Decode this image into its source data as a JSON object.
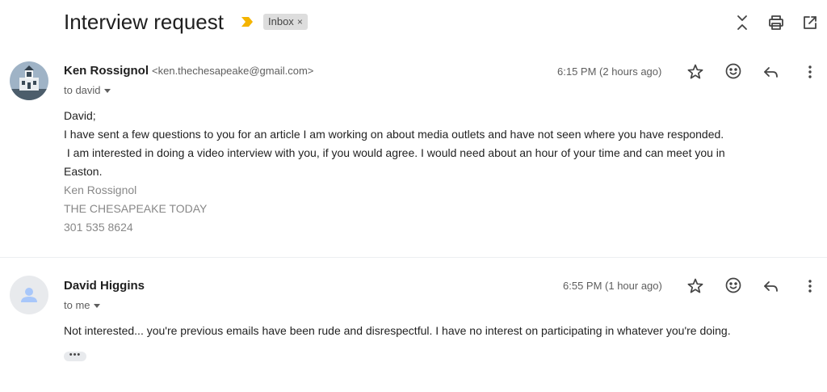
{
  "subject": "Interview request",
  "label": {
    "name": "Inbox",
    "close": "×"
  },
  "toolbar": {
    "icons": [
      "expand-collapse-icon",
      "print-icon",
      "open-new-window-icon"
    ]
  },
  "messages": [
    {
      "sender_name": "Ken Rossignol",
      "sender_email": "<ken.thechesapeake@gmail.com>",
      "to": "to david",
      "time": "6:15 PM (2 hours ago)",
      "body": [
        "David;",
        "I have sent a few questions to you for an article I am working on about media outlets and have not seen where you have responded.",
        " I am interested in doing a video interview with you, if you would agree. I would need about an hour of your time and can meet you in",
        "Easton."
      ],
      "signature": [
        "Ken Rossignol",
        "THE CHESAPEAKE TODAY",
        "301 535 8624"
      ]
    },
    {
      "sender_name": "David Higgins",
      "to": "to me",
      "time": "6:55 PM (1 hour ago)",
      "body": [
        "Not interested... you're previous emails have been rude and disrespectful. I have no interest on participating in whatever you're doing."
      ],
      "trimmed_content_button": "•••"
    }
  ],
  "message_icons": [
    "star-icon",
    "emoji-reaction-icon",
    "reply-icon",
    "more-vert-icon"
  ],
  "colors": {
    "importance_marker": "#f4b400",
    "label_chip_bg": "#dddddd",
    "default_avatar_bg": "#e8eaed",
    "default_avatar_fg": "#a8c7fa"
  }
}
